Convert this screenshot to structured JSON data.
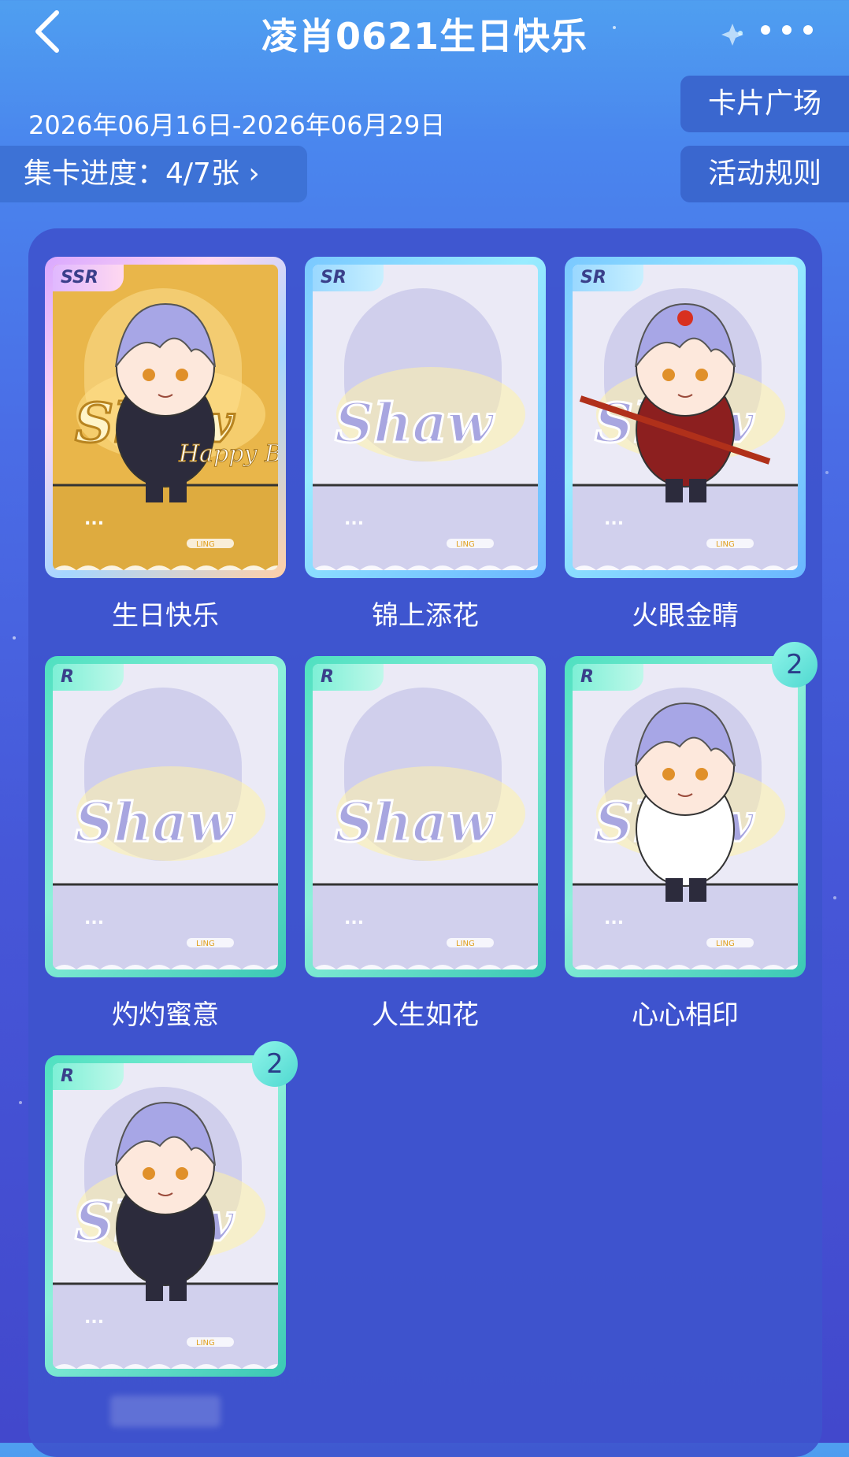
{
  "header": {
    "title": "凌肖0621生日快乐"
  },
  "event": {
    "date_range": "2026年06月16日-2026年06月29日",
    "progress_label": "集卡进度：4/7张 ›"
  },
  "buttons": {
    "card_plaza": "卡片广场",
    "activity_rules": "活动规则"
  },
  "cards": [
    {
      "name": "生日快乐",
      "rarity": "SSR",
      "count": null,
      "art": "birthday"
    },
    {
      "name": "锦上添花",
      "rarity": "SR",
      "count": null,
      "art": "placeholder"
    },
    {
      "name": "火眼金睛",
      "rarity": "SR",
      "count": null,
      "art": "monkey"
    },
    {
      "name": "灼灼蜜意",
      "rarity": "R",
      "count": null,
      "art": "placeholder"
    },
    {
      "name": "人生如花",
      "rarity": "R",
      "count": null,
      "art": "placeholder"
    },
    {
      "name": "心心相印",
      "rarity": "R",
      "count": "2",
      "art": "jacket"
    },
    {
      "name": "",
      "rarity": "R",
      "count": "2",
      "art": "sitting"
    }
  ],
  "card_art_text": {
    "logo": "Shaw",
    "brand": "LING",
    "birthday_text": "Happy Birthday"
  },
  "icons": {
    "back": "chevron-left-icon",
    "more": "more-dots-icon"
  }
}
